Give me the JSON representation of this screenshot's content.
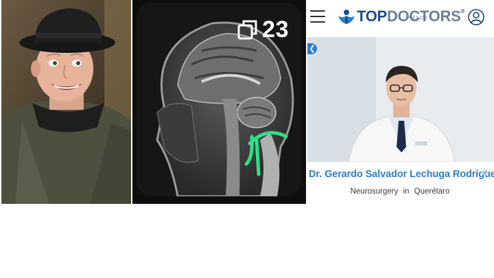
{
  "mri": {
    "gallery_count": "23"
  },
  "topdoctors": {
    "logo_bold": "TOP",
    "logo_light": "DOCTORS",
    "logo_reg": "®",
    "logo_country": "MÉXICO",
    "doctor_name": "Dr. Gerardo Salvador Lechuga Rodríguez",
    "specialty": "Neurosurgery",
    "in_word": "in",
    "city": "Querétaro"
  },
  "colors": {
    "brand_blue": "#1b4d8a",
    "name_blue": "#2f7fc5",
    "arrow_green": "#2fe08a"
  }
}
